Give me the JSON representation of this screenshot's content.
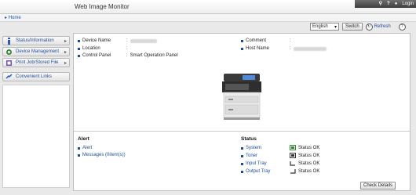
{
  "header": {
    "title": "Web Image Monitor",
    "icons": [
      "search-icon",
      "help-icon",
      "user-icon"
    ],
    "login_label": "Login"
  },
  "breadcrumb": {
    "home": "Home"
  },
  "sidebar": {
    "items": [
      {
        "label": "Status/Information",
        "icon": "info-icon"
      },
      {
        "label": "Device Management",
        "icon": "device-icon"
      },
      {
        "label": "Print Job/Stored File",
        "icon": "print-job-icon"
      },
      {
        "label": "Convenient Links",
        "icon": "links-icon"
      }
    ]
  },
  "toolbar": {
    "language": "English",
    "switch_label": "Switch",
    "refresh_label": "Refresh",
    "help_icon": "help-icon"
  },
  "device_info": {
    "device_name_label": "Device Name",
    "location_label": "Location",
    "control_panel_label": "Control Panel",
    "control_panel_value": "Smart Operation Panel",
    "comment_label": "Comment",
    "host_name_label": "Host Name",
    "colon": ":"
  },
  "alert": {
    "title": "Alert",
    "alert_link": "Alert",
    "messages_link": "Messages (0item(s))"
  },
  "status": {
    "title": "Status",
    "items": [
      {
        "label": "System",
        "value": "Status OK",
        "icon": "system-ok-icon"
      },
      {
        "label": "Toner",
        "value": "Status OK",
        "icon": "toner-icon"
      },
      {
        "label": "Input Tray",
        "value": "Status OK",
        "icon": "input-tray-icon"
      },
      {
        "label": "Output Tray",
        "value": "Status OK",
        "icon": "output-tray-icon"
      }
    ]
  },
  "buttons": {
    "check_details": "Check Details"
  },
  "colors": {
    "link": "#1d4d99",
    "header_dark": "#3d3d3d",
    "panel_bg": "#ffffff"
  }
}
